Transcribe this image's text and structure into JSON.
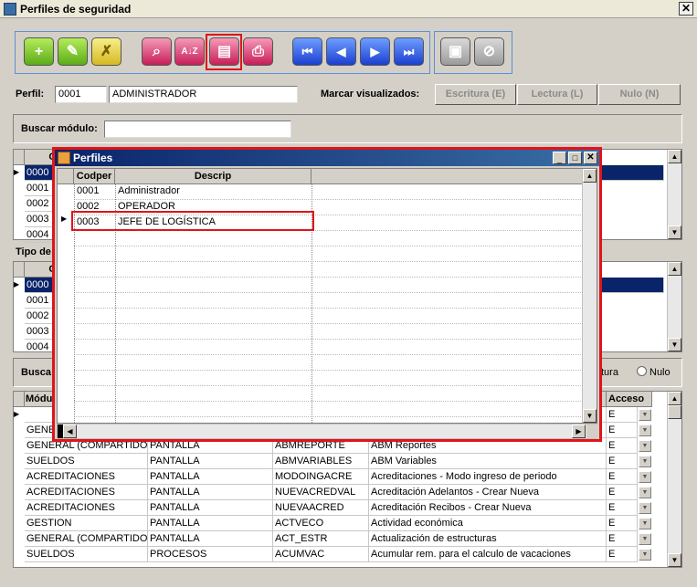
{
  "window": {
    "title": "Perfiles de seguridad",
    "close": "✕"
  },
  "toolbar": {
    "add": "+",
    "edit": "✎",
    "delete": "✗",
    "search": "⌕",
    "sort": "A↓Z",
    "report": "▤",
    "print": "⎙",
    "first": "⏮",
    "prev": "◀",
    "next": "▶",
    "last": "⏭",
    "save": "▣",
    "cancel": "⊘"
  },
  "perfil": {
    "label": "Perfil:",
    "code": "0001",
    "name": "ADMINISTRADOR"
  },
  "marcar": {
    "label": "Marcar visualizados:",
    "escritura": "Escritura (E)",
    "lectura": "Lectura (L)",
    "nulo": "Nulo (N)"
  },
  "buscar_modulo": {
    "label": "Buscar módulo:",
    "value": ""
  },
  "grid1": {
    "header": "Có",
    "rows": [
      "0000",
      "0001",
      "0002",
      "0003",
      "0004"
    ]
  },
  "tipo_label": "Tipo de",
  "grid2": {
    "header": "Có",
    "rows": [
      "0000",
      "0001",
      "0002",
      "0003",
      "0004"
    ]
  },
  "buscar2_label": "Busca",
  "radio": {
    "lectura_partial": "tura",
    "nulo": "Nulo"
  },
  "modgrid": {
    "headers": {
      "modulo": "Módu",
      "acceso": "Acceso"
    },
    "rows": [
      {
        "a": "",
        "b": "",
        "c": "",
        "d": "",
        "e": "E"
      },
      {
        "a": "GENE",
        "b": "",
        "c": "",
        "d": "",
        "e": "E"
      },
      {
        "a": "GENERAL (COMPARTIDO)",
        "b": "PANTALLA",
        "c": "ABMREPORTE",
        "d": "ABM Reportes",
        "e": "E"
      },
      {
        "a": "SUELDOS",
        "b": "PANTALLA",
        "c": "ABMVARIABLES",
        "d": "ABM Variables",
        "e": "E"
      },
      {
        "a": "ACREDITACIONES",
        "b": "PANTALLA",
        "c": "MODOINGACRE",
        "d": "Acreditaciones - Modo ingreso de periodo",
        "e": "E"
      },
      {
        "a": "ACREDITACIONES",
        "b": "PANTALLA",
        "c": "NUEVACREDVAL",
        "d": "Acreditación Adelantos - Crear Nueva",
        "e": "E"
      },
      {
        "a": "ACREDITACIONES",
        "b": "PANTALLA",
        "c": "NUEVAACRED",
        "d": "Acreditación Recibos - Crear Nueva",
        "e": "E"
      },
      {
        "a": "GESTION",
        "b": "PANTALLA",
        "c": "ACTVECO",
        "d": "Actividad económica",
        "e": "E"
      },
      {
        "a": "GENERAL (COMPARTIDO)",
        "b": "PANTALLA",
        "c": "ACT_ESTR",
        "d": "Actualización de estructuras",
        "e": "E"
      },
      {
        "a": "SUELDOS",
        "b": "PROCESOS",
        "c": "ACUMVAC",
        "d": "Acumular rem. para el calculo de vacaciones",
        "e": "E"
      }
    ]
  },
  "popup": {
    "title": "Perfiles",
    "headers": {
      "codper": "Codper",
      "descrip": "Descrip"
    },
    "rows": [
      {
        "code": "0001",
        "desc": "Administrador"
      },
      {
        "code": "0002",
        "desc": "OPERADOR"
      },
      {
        "code": "0003",
        "desc": "JEFE DE LOGÍSTICA"
      }
    ]
  },
  "colors": {
    "highlight": "#e0141b",
    "selection": "#0a246a",
    "title_gradient": "#0a246a"
  }
}
